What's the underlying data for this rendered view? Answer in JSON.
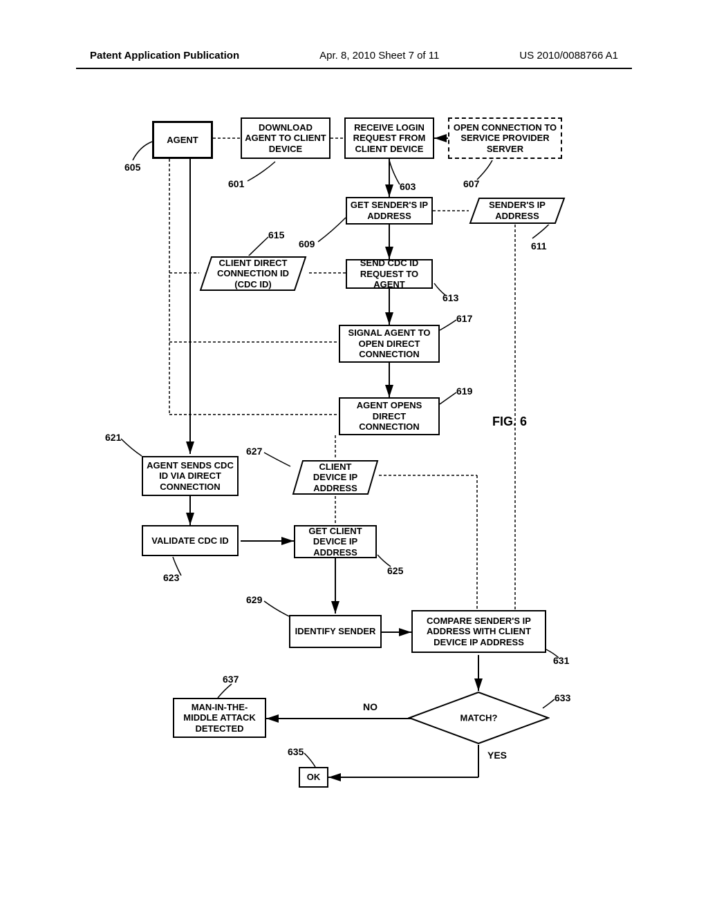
{
  "header": {
    "left": "Patent Application Publication",
    "center": "Apr. 8, 2010  Sheet 7 of 11",
    "right": "US 2010/0088766 A1"
  },
  "figure_label": "FIG. 6",
  "boxes": {
    "agent": "AGENT",
    "download": "DOWNLOAD AGENT TO CLIENT DEVICE",
    "receive": "RECEIVE LOGIN REQUEST FROM CLIENT DEVICE",
    "open_conn": "OPEN CONNECTION TO SERVICE PROVIDER SERVER",
    "get_sender": "GET SENDER'S IP ADDRESS",
    "sender_ip": "SENDER'S IP ADDRESS",
    "cdc_id": "CLIENT DIRECT CONNECTION ID (CDC ID)",
    "send_cdc": "SEND CDC ID REQUEST TO AGENT",
    "signal": "SIGNAL AGENT TO OPEN DIRECT CONNECTION",
    "agent_opens": "AGENT OPENS DIRECT CONNECTION",
    "sends_cdc": "AGENT SENDS CDC ID VIA DIRECT CONNECTION",
    "client_ip_data": "CLIENT DEVICE IP ADDRESS",
    "validate": "VALIDATE CDC ID",
    "get_client": "GET CLIENT DEVICE IP ADDRESS",
    "identify": "IDENTIFY SENDER",
    "compare": "COMPARE SENDER'S IP ADDRESS WITH CLIENT DEVICE IP ADDRESS",
    "mitm": "MAN-IN-THE-MIDDLE ATTACK DETECTED",
    "ok": "OK",
    "match": "MATCH?",
    "no": "NO",
    "yes": "YES"
  },
  "labels": {
    "l601": "601",
    "l603": "603",
    "l605": "605",
    "l607": "607",
    "l609": "609",
    "l611": "611",
    "l613": "613",
    "l615": "615",
    "l617": "617",
    "l619": "619",
    "l621": "621",
    "l623": "623",
    "l625": "625",
    "l627": "627",
    "l629": "629",
    "l631": "631",
    "l633": "633",
    "l635": "635",
    "l637": "637"
  }
}
